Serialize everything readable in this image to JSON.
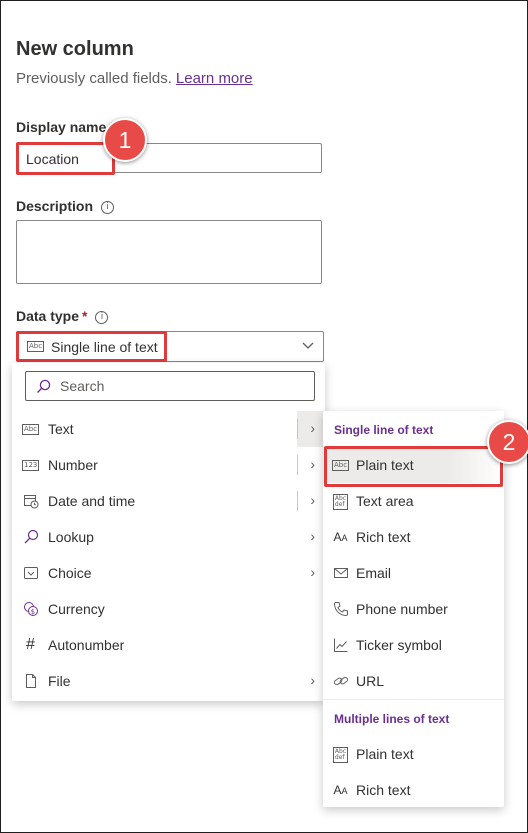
{
  "panel": {
    "title": "New column",
    "subtitle": "Previously called fields.",
    "learn_more": "Learn more"
  },
  "display_name": {
    "label": "Display name",
    "required": "*",
    "value": "Location"
  },
  "description": {
    "label": "Description",
    "value": ""
  },
  "data_type": {
    "label": "Data type",
    "required": "*",
    "selected": "Single line of text",
    "search_placeholder": "Search"
  },
  "menu": {
    "items": [
      {
        "label": "Text",
        "icon": "abc-icon",
        "has_submenu": true
      },
      {
        "label": "Number",
        "icon": "number-icon",
        "has_submenu": true
      },
      {
        "label": "Date and time",
        "icon": "calendar-clock-icon",
        "has_submenu": true
      },
      {
        "label": "Lookup",
        "icon": "lookup-icon",
        "has_submenu": true
      },
      {
        "label": "Choice",
        "icon": "choice-icon",
        "has_submenu": true
      },
      {
        "label": "Currency",
        "icon": "currency-icon",
        "has_submenu": false
      },
      {
        "label": "Autonumber",
        "icon": "hash-icon",
        "has_submenu": false
      },
      {
        "label": "File",
        "icon": "file-icon",
        "has_submenu": true
      }
    ]
  },
  "submenu": {
    "single_header": "Single line of text",
    "single_items": [
      {
        "label": "Plain text",
        "icon": "abc-icon"
      },
      {
        "label": "Text area",
        "icon": "abc-def-icon"
      },
      {
        "label": "Rich text",
        "icon": "rich-text-icon"
      },
      {
        "label": "Email",
        "icon": "email-icon"
      },
      {
        "label": "Phone number",
        "icon": "phone-icon"
      },
      {
        "label": "Ticker symbol",
        "icon": "ticker-icon"
      },
      {
        "label": "URL",
        "icon": "link-icon"
      }
    ],
    "multi_header": "Multiple lines of text",
    "multi_items": [
      {
        "label": "Plain text",
        "icon": "abc-def-icon"
      },
      {
        "label": "Rich text",
        "icon": "rich-text-icon"
      }
    ]
  },
  "callouts": {
    "one": "1",
    "two": "2"
  },
  "colors": {
    "accent": "#6b2f8f",
    "highlight": "#e03a3a",
    "badge": "#e84b47"
  }
}
